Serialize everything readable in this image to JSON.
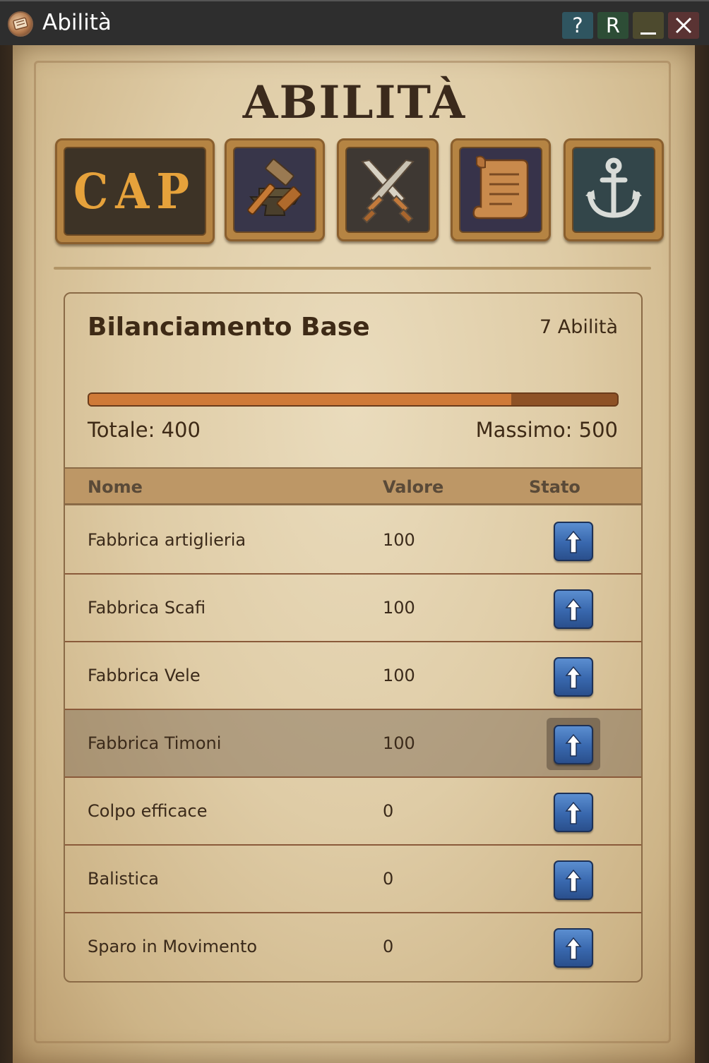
{
  "window": {
    "title": "Abilità",
    "help_label": "?",
    "r_label": "R"
  },
  "panel": {
    "title": "ABILITÀ",
    "tabs": [
      {
        "label": "CAP",
        "icon": "cap-text"
      },
      {
        "label": "",
        "icon": "hammer-anvil-icon"
      },
      {
        "label": "",
        "icon": "crossed-swords-icon"
      },
      {
        "label": "",
        "icon": "scroll-icon"
      },
      {
        "label": "",
        "icon": "anchor-icon"
      }
    ]
  },
  "card": {
    "title": "Bilanciamento Base",
    "count_label": "7 Abilità",
    "progress_fraction": 0.8,
    "total_label": "Totale: 400",
    "max_label": "Massimo: 500"
  },
  "table": {
    "headers": {
      "name": "Nome",
      "value": "Valore",
      "status": "Stato"
    },
    "rows": [
      {
        "name": "Fabbrica artiglieria",
        "value": "100"
      },
      {
        "name": "Fabbrica Scafi",
        "value": "100"
      },
      {
        "name": "Fabbrica Vele",
        "value": "100"
      },
      {
        "name": "Fabbrica Timoni",
        "value": "100"
      },
      {
        "name": "Colpo efficace",
        "value": "0"
      },
      {
        "name": "Balistica",
        "value": "0"
      },
      {
        "name": "Sparo in Movimento",
        "value": "0"
      }
    ],
    "highlighted_row": 3
  },
  "colors": {
    "accent_orange": "#cf7a38",
    "button_blue": "#3867ad",
    "text_brown": "#3e2a16"
  }
}
